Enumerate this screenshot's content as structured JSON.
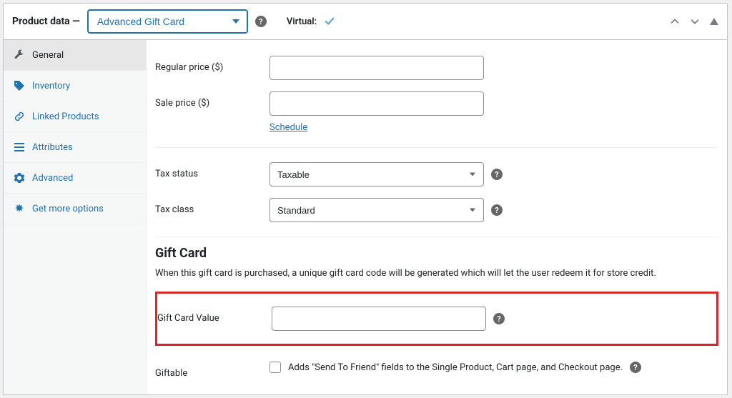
{
  "header": {
    "title_prefix": "Product data —",
    "product_type": "Advanced Gift Card",
    "virtual_label": "Virtual:",
    "virtual_checked": true
  },
  "sidebar": {
    "items": [
      {
        "label": "General",
        "active": true
      },
      {
        "label": "Inventory",
        "active": false
      },
      {
        "label": "Linked Products",
        "active": false
      },
      {
        "label": "Attributes",
        "active": false
      },
      {
        "label": "Advanced",
        "active": false
      },
      {
        "label": "Get more options",
        "active": false
      }
    ]
  },
  "fields": {
    "regular_price": {
      "label": "Regular price ($)",
      "value": ""
    },
    "sale_price": {
      "label": "Sale price ($)",
      "value": "",
      "schedule_link": "Schedule"
    },
    "tax_status": {
      "label": "Tax status",
      "value": "Taxable"
    },
    "tax_class": {
      "label": "Tax class",
      "value": "Standard"
    }
  },
  "gift_card": {
    "heading": "Gift Card",
    "description": "When this gift card is purchased, a unique gift card code will be generated which will let the user redeem it for store credit.",
    "value_field": {
      "label": "Gift Card Value",
      "value": ""
    },
    "giftable": {
      "label": "Giftable",
      "checked": false,
      "description": "Adds \"Send To Friend\" fields to the Single Product, Cart page, and Checkout page."
    }
  }
}
